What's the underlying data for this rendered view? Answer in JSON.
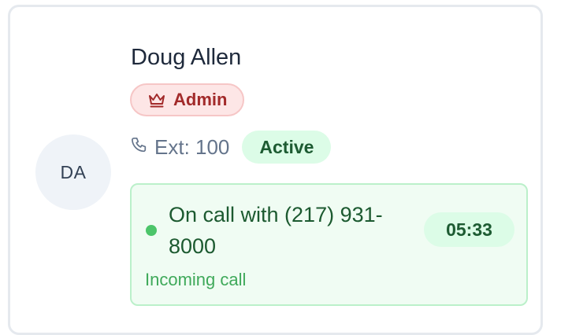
{
  "contact": {
    "initials": "DA",
    "name": "Doug Allen",
    "role_badge": {
      "label": "Admin",
      "icon": "crown-icon",
      "color": "#a22a2a",
      "background": "#fde6e6"
    },
    "extension": {
      "icon": "phone-icon",
      "label": "Ext: 100"
    },
    "status": {
      "label": "Active",
      "color": "#1d5b32",
      "background": "#dcfce7"
    }
  },
  "call": {
    "text": "On call with (217) 931-8000",
    "timer": "05:33",
    "direction": "Incoming call",
    "indicator_color": "#4cc56a"
  }
}
